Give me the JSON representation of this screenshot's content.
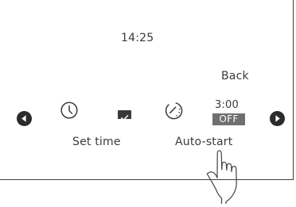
{
  "display": {
    "current_time": "14:25",
    "back_label": "Back",
    "set_time_label": "Set time",
    "auto_start_label": "Auto-start",
    "auto_start_time": "3:00",
    "auto_start_state": "OFF"
  },
  "icons": {
    "left_arrow": "left-arrow-icon",
    "right_arrow": "right-arrow-icon",
    "clock": "clock-icon",
    "check": "check-icon",
    "timer": "timer-icon",
    "hand": "pointing-hand-icon"
  },
  "colors": {
    "text": "#3a3a3a",
    "dark": "#2b2b2b",
    "badge": "#6f6f6f"
  }
}
